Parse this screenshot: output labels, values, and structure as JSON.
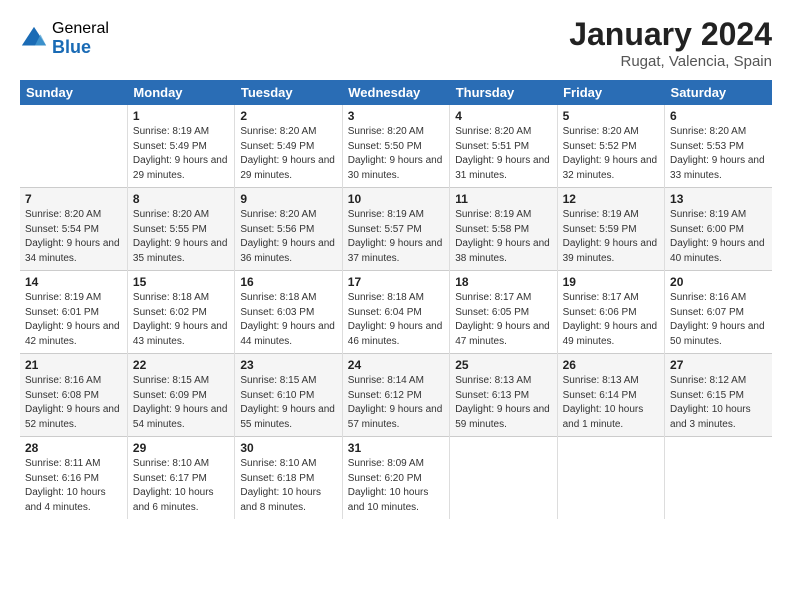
{
  "logo": {
    "general": "General",
    "blue": "Blue"
  },
  "title": "January 2024",
  "location": "Rugat, Valencia, Spain",
  "days_of_week": [
    "Sunday",
    "Monday",
    "Tuesday",
    "Wednesday",
    "Thursday",
    "Friday",
    "Saturday"
  ],
  "weeks": [
    [
      {
        "day": "",
        "sunrise": "",
        "sunset": "",
        "daylight": ""
      },
      {
        "day": "1",
        "sunrise": "Sunrise: 8:19 AM",
        "sunset": "Sunset: 5:49 PM",
        "daylight": "Daylight: 9 hours and 29 minutes."
      },
      {
        "day": "2",
        "sunrise": "Sunrise: 8:20 AM",
        "sunset": "Sunset: 5:49 PM",
        "daylight": "Daylight: 9 hours and 29 minutes."
      },
      {
        "day": "3",
        "sunrise": "Sunrise: 8:20 AM",
        "sunset": "Sunset: 5:50 PM",
        "daylight": "Daylight: 9 hours and 30 minutes."
      },
      {
        "day": "4",
        "sunrise": "Sunrise: 8:20 AM",
        "sunset": "Sunset: 5:51 PM",
        "daylight": "Daylight: 9 hours and 31 minutes."
      },
      {
        "day": "5",
        "sunrise": "Sunrise: 8:20 AM",
        "sunset": "Sunset: 5:52 PM",
        "daylight": "Daylight: 9 hours and 32 minutes."
      },
      {
        "day": "6",
        "sunrise": "Sunrise: 8:20 AM",
        "sunset": "Sunset: 5:53 PM",
        "daylight": "Daylight: 9 hours and 33 minutes."
      }
    ],
    [
      {
        "day": "7",
        "sunrise": "Sunrise: 8:20 AM",
        "sunset": "Sunset: 5:54 PM",
        "daylight": "Daylight: 9 hours and 34 minutes."
      },
      {
        "day": "8",
        "sunrise": "Sunrise: 8:20 AM",
        "sunset": "Sunset: 5:55 PM",
        "daylight": "Daylight: 9 hours and 35 minutes."
      },
      {
        "day": "9",
        "sunrise": "Sunrise: 8:20 AM",
        "sunset": "Sunset: 5:56 PM",
        "daylight": "Daylight: 9 hours and 36 minutes."
      },
      {
        "day": "10",
        "sunrise": "Sunrise: 8:19 AM",
        "sunset": "Sunset: 5:57 PM",
        "daylight": "Daylight: 9 hours and 37 minutes."
      },
      {
        "day": "11",
        "sunrise": "Sunrise: 8:19 AM",
        "sunset": "Sunset: 5:58 PM",
        "daylight": "Daylight: 9 hours and 38 minutes."
      },
      {
        "day": "12",
        "sunrise": "Sunrise: 8:19 AM",
        "sunset": "Sunset: 5:59 PM",
        "daylight": "Daylight: 9 hours and 39 minutes."
      },
      {
        "day": "13",
        "sunrise": "Sunrise: 8:19 AM",
        "sunset": "Sunset: 6:00 PM",
        "daylight": "Daylight: 9 hours and 40 minutes."
      }
    ],
    [
      {
        "day": "14",
        "sunrise": "Sunrise: 8:19 AM",
        "sunset": "Sunset: 6:01 PM",
        "daylight": "Daylight: 9 hours and 42 minutes."
      },
      {
        "day": "15",
        "sunrise": "Sunrise: 8:18 AM",
        "sunset": "Sunset: 6:02 PM",
        "daylight": "Daylight: 9 hours and 43 minutes."
      },
      {
        "day": "16",
        "sunrise": "Sunrise: 8:18 AM",
        "sunset": "Sunset: 6:03 PM",
        "daylight": "Daylight: 9 hours and 44 minutes."
      },
      {
        "day": "17",
        "sunrise": "Sunrise: 8:18 AM",
        "sunset": "Sunset: 6:04 PM",
        "daylight": "Daylight: 9 hours and 46 minutes."
      },
      {
        "day": "18",
        "sunrise": "Sunrise: 8:17 AM",
        "sunset": "Sunset: 6:05 PM",
        "daylight": "Daylight: 9 hours and 47 minutes."
      },
      {
        "day": "19",
        "sunrise": "Sunrise: 8:17 AM",
        "sunset": "Sunset: 6:06 PM",
        "daylight": "Daylight: 9 hours and 49 minutes."
      },
      {
        "day": "20",
        "sunrise": "Sunrise: 8:16 AM",
        "sunset": "Sunset: 6:07 PM",
        "daylight": "Daylight: 9 hours and 50 minutes."
      }
    ],
    [
      {
        "day": "21",
        "sunrise": "Sunrise: 8:16 AM",
        "sunset": "Sunset: 6:08 PM",
        "daylight": "Daylight: 9 hours and 52 minutes."
      },
      {
        "day": "22",
        "sunrise": "Sunrise: 8:15 AM",
        "sunset": "Sunset: 6:09 PM",
        "daylight": "Daylight: 9 hours and 54 minutes."
      },
      {
        "day": "23",
        "sunrise": "Sunrise: 8:15 AM",
        "sunset": "Sunset: 6:10 PM",
        "daylight": "Daylight: 9 hours and 55 minutes."
      },
      {
        "day": "24",
        "sunrise": "Sunrise: 8:14 AM",
        "sunset": "Sunset: 6:12 PM",
        "daylight": "Daylight: 9 hours and 57 minutes."
      },
      {
        "day": "25",
        "sunrise": "Sunrise: 8:13 AM",
        "sunset": "Sunset: 6:13 PM",
        "daylight": "Daylight: 9 hours and 59 minutes."
      },
      {
        "day": "26",
        "sunrise": "Sunrise: 8:13 AM",
        "sunset": "Sunset: 6:14 PM",
        "daylight": "Daylight: 10 hours and 1 minute."
      },
      {
        "day": "27",
        "sunrise": "Sunrise: 8:12 AM",
        "sunset": "Sunset: 6:15 PM",
        "daylight": "Daylight: 10 hours and 3 minutes."
      }
    ],
    [
      {
        "day": "28",
        "sunrise": "Sunrise: 8:11 AM",
        "sunset": "Sunset: 6:16 PM",
        "daylight": "Daylight: 10 hours and 4 minutes."
      },
      {
        "day": "29",
        "sunrise": "Sunrise: 8:10 AM",
        "sunset": "Sunset: 6:17 PM",
        "daylight": "Daylight: 10 hours and 6 minutes."
      },
      {
        "day": "30",
        "sunrise": "Sunrise: 8:10 AM",
        "sunset": "Sunset: 6:18 PM",
        "daylight": "Daylight: 10 hours and 8 minutes."
      },
      {
        "day": "31",
        "sunrise": "Sunrise: 8:09 AM",
        "sunset": "Sunset: 6:20 PM",
        "daylight": "Daylight: 10 hours and 10 minutes."
      },
      {
        "day": "",
        "sunrise": "",
        "sunset": "",
        "daylight": ""
      },
      {
        "day": "",
        "sunrise": "",
        "sunset": "",
        "daylight": ""
      },
      {
        "day": "",
        "sunrise": "",
        "sunset": "",
        "daylight": ""
      }
    ]
  ]
}
